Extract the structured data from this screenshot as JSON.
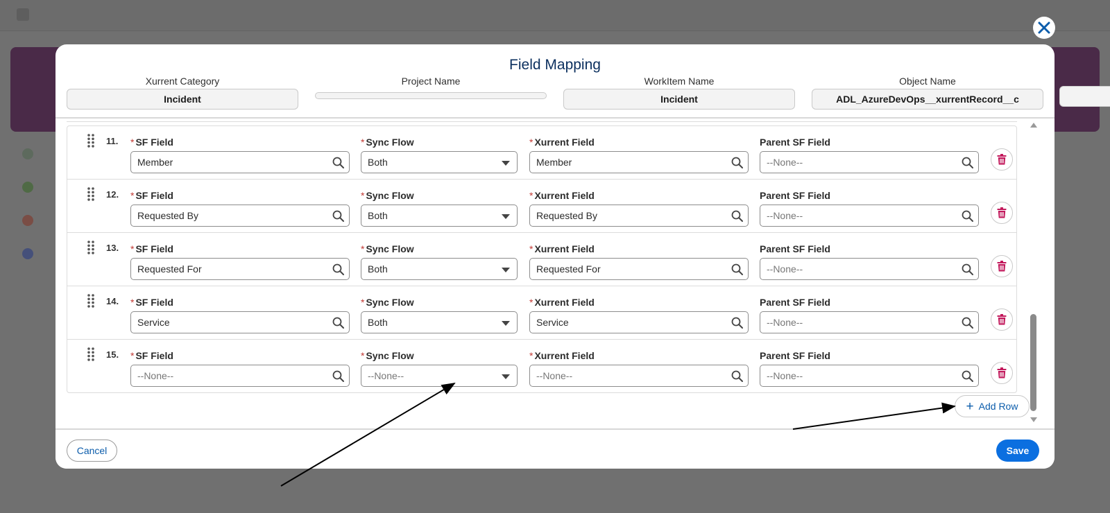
{
  "modal": {
    "title": "Field Mapping",
    "header_fields": [
      {
        "label": "Xurrent Category",
        "value": "Incident"
      },
      {
        "label": "Project Name",
        "value": ""
      },
      {
        "label": "WorkItem Name",
        "value": "Incident"
      },
      {
        "label": "Object Name",
        "value": "ADL_AzureDevOps__xurrentRecord__c"
      }
    ]
  },
  "row_labels": {
    "sf_field": "SF Field",
    "sync_flow": "Sync Flow",
    "xurrent_field": "Xurrent Field",
    "parent_sf_field": "Parent SF Field",
    "required_mark": "*"
  },
  "rows": [
    {
      "num": "11.",
      "sf_field": "Member",
      "sync_flow": "Both",
      "xurrent_field": "Member",
      "parent_sf_field": "--None--"
    },
    {
      "num": "12.",
      "sf_field": "Requested By",
      "sync_flow": "Both",
      "xurrent_field": "Requested By",
      "parent_sf_field": "--None--"
    },
    {
      "num": "13.",
      "sf_field": "Requested For",
      "sync_flow": "Both",
      "xurrent_field": "Requested For",
      "parent_sf_field": "--None--"
    },
    {
      "num": "14.",
      "sf_field": "Service",
      "sync_flow": "Both",
      "xurrent_field": "Service",
      "parent_sf_field": "--None--"
    },
    {
      "num": "15.",
      "sf_field": "--None--",
      "sync_flow": "--None--",
      "xurrent_field": "--None--",
      "parent_sf_field": "--None--"
    }
  ],
  "buttons": {
    "add_row": "Add Row",
    "add_row_icon": "+",
    "cancel": "Cancel",
    "save": "Save"
  },
  "icons": {
    "close": "close-icon",
    "search": "search-icon",
    "dropdown": "chevron-down-icon",
    "drag": "drag-handle-icon",
    "delete": "trash-icon"
  },
  "colors": {
    "brand_blue": "#0b5cab",
    "save_blue": "#0b6fe0",
    "delete_pink": "#c2185b",
    "required_red": "#c23934",
    "title_navy": "#0b2f5e"
  }
}
